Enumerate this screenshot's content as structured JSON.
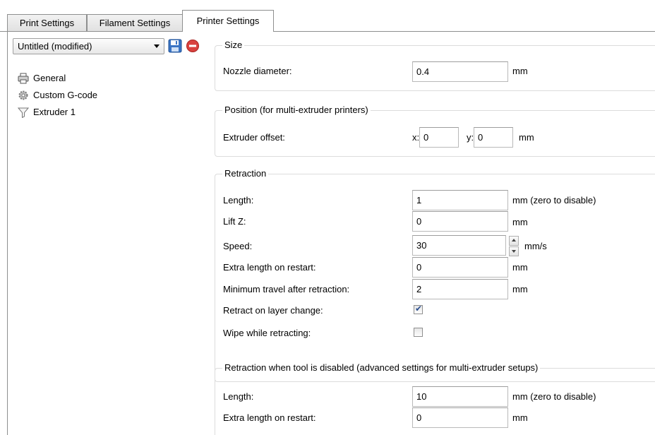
{
  "tabs": [
    {
      "label": "Print Settings",
      "active": false
    },
    {
      "label": "Filament Settings",
      "active": false
    },
    {
      "label": "Printer Settings",
      "active": true
    }
  ],
  "preset": {
    "selected": "Untitled (modified)",
    "save_icon": "save-icon",
    "delete_icon": "delete-icon"
  },
  "tree": {
    "items": [
      {
        "label": "General",
        "icon": "printer-icon"
      },
      {
        "label": "Custom G-code",
        "icon": "cog-icon"
      },
      {
        "label": "Extruder 1",
        "icon": "funnel-icon",
        "selected": true
      }
    ]
  },
  "size": {
    "title": "Size",
    "nozzle_label": "Nozzle diameter:",
    "nozzle_value": "0.4",
    "nozzle_unit": "mm"
  },
  "position": {
    "title": "Position (for multi-extruder printers)",
    "offset_label": "Extruder offset:",
    "x_label": "x:",
    "x_value": "0",
    "y_label": "y:",
    "y_value": "0",
    "unit": "mm"
  },
  "retraction": {
    "title": "Retraction",
    "length_label": "Length:",
    "length_value": "1",
    "length_unit": "mm (zero to disable)",
    "liftz_label": "Lift Z:",
    "liftz_value": "0",
    "liftz_unit": "mm",
    "speed_label": "Speed:",
    "speed_value": "30",
    "speed_unit": "mm/s",
    "extra_label": "Extra length on restart:",
    "extra_value": "0",
    "extra_unit": "mm",
    "mintravel_label": "Minimum travel after retraction:",
    "mintravel_value": "2",
    "mintravel_unit": "mm",
    "layer_change_label": "Retract on layer change:",
    "layer_change_checked": true,
    "wipe_label": "Wipe while retracting:",
    "wipe_checked": false
  },
  "retraction_disabled": {
    "title": "Retraction when tool is disabled (advanced settings for multi-extruder setups)",
    "length_label": "Length:",
    "length_value": "10",
    "length_unit": "mm (zero to disable)",
    "extra_label": "Extra length on restart:",
    "extra_value": "0",
    "extra_unit": "mm"
  },
  "colors": {
    "border": "#8e8f8f",
    "group_border": "#dcdcdc",
    "check_mark": "#2c4f8f",
    "save_icon_blue": "#3a74c4",
    "delete_icon_red": "#d9413e"
  }
}
